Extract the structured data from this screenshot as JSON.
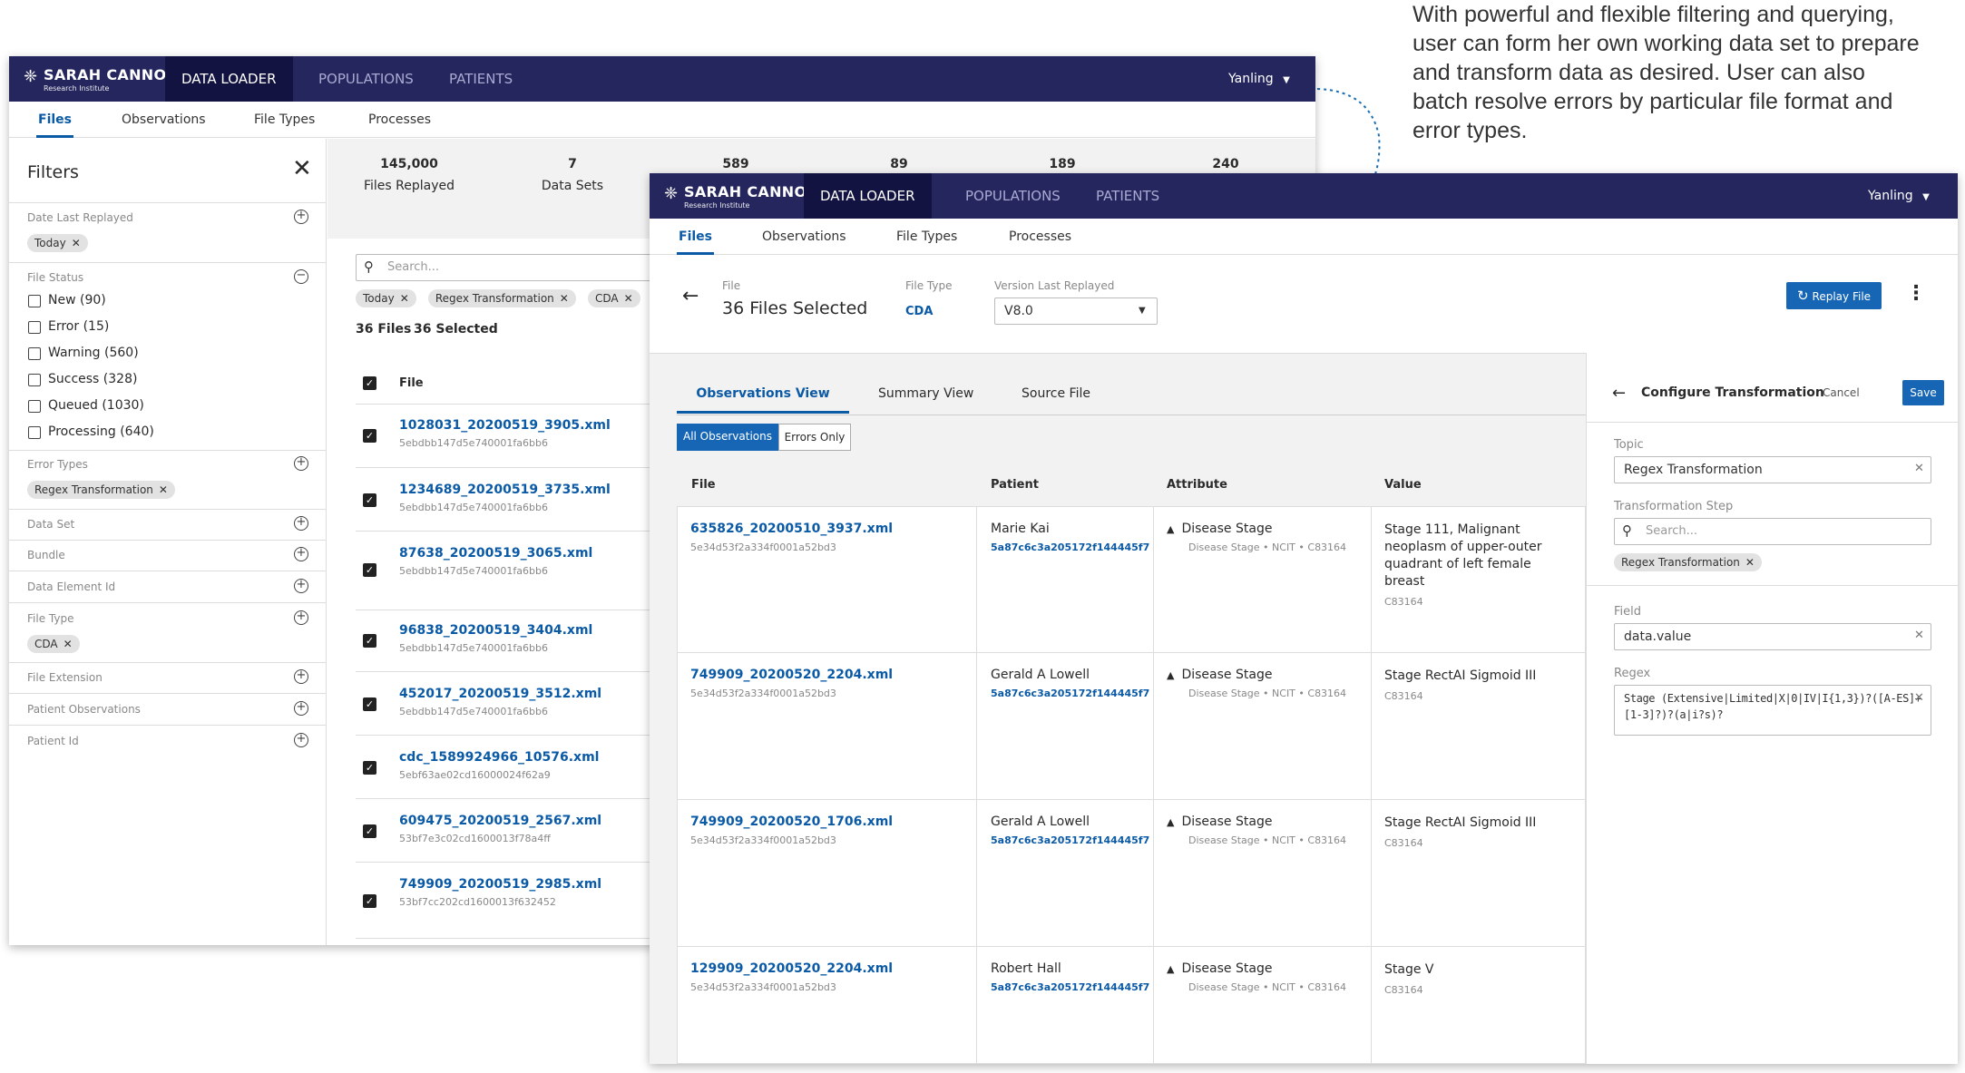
{
  "annotation": {
    "lines": [
      "With powerful and flexible filtering and querying,",
      "user can form her own working data set to prepare",
      "and transform data as desired. User can also",
      "batch resolve errors by particular file format and",
      "error types."
    ]
  },
  "brand": {
    "name": "SARAH CANNON",
    "sub": "Research Institute"
  },
  "nav": {
    "data_loader": "DATA LOADER",
    "populations": "POPULATIONS",
    "patients": "PATIENTS",
    "user": "Yanling"
  },
  "subnav": {
    "files": "Files",
    "observations": "Observations",
    "file_types": "File Types",
    "processes": "Processes"
  },
  "back_window": {
    "filters": {
      "title": "Filters",
      "date_last_replayed": "Date Last Replayed",
      "date_chip": "Today",
      "file_status": "File Status",
      "statuses": [
        "New (90)",
        "Error (15)",
        "Warning (560)",
        "Success (328)",
        "Queued (1030)",
        "Processing (640)"
      ],
      "error_types": "Error Types",
      "error_chip": "Regex Transformation",
      "data_set": "Data Set",
      "bundle": "Bundle",
      "data_element_id": "Data Element Id",
      "file_type": "File Type",
      "file_type_chip": "CDA",
      "file_extension": "File Extension",
      "patient_observations": "Patient Observations",
      "patient_id": "Patient Id"
    },
    "stats": [
      {
        "value": "145,000",
        "label": "Files Replayed"
      },
      {
        "value": "7",
        "label": "Data Sets"
      },
      {
        "value": "589",
        "label": ""
      },
      {
        "value": "89",
        "label": ""
      },
      {
        "value": "189",
        "label": ""
      },
      {
        "value": "240",
        "label": ""
      }
    ],
    "search_placeholder": "Search...",
    "chips": [
      "Today",
      "Regex Transformation",
      "CDA"
    ],
    "count_files": "36 Files",
    "count_selected": "36 Selected",
    "col_file": "File",
    "files": [
      {
        "name": "1028031_20200519_3905.xml",
        "hash": "5ebdbb147d5e740001fa6bb6"
      },
      {
        "name": "1234689_20200519_3735.xml",
        "hash": "5ebdbb147d5e740001fa6bb6"
      },
      {
        "name": "87638_20200519_3065.xml",
        "hash": "5ebdbb147d5e740001fa6bb6"
      },
      {
        "name": "96838_20200519_3404.xml",
        "hash": "5ebdbb147d5e740001fa6bb6"
      },
      {
        "name": "452017_20200519_3512.xml",
        "hash": "5ebdbb147d5e740001fa6bb6"
      },
      {
        "name": "cdc_1589924966_10576.xml",
        "hash": "5ebf63ae02cd16000024f62a9"
      },
      {
        "name": "609475_20200519_2567.xml",
        "hash": "53bf7e3c02cd1600013f78a4ff"
      },
      {
        "name": "749909_20200519_2985.xml",
        "hash": "53bf7cc202cd1600013f632452"
      }
    ]
  },
  "front_window": {
    "header": {
      "file_label": "File",
      "file_value": "36 Files Selected",
      "file_type_label": "File Type",
      "file_type_value": "CDA",
      "version_label": "Version Last Replayed",
      "version_value": "V8.0",
      "replay_button": "Replay File"
    },
    "view_tabs": {
      "observations": "Observations View",
      "summary": "Summary View",
      "source": "Source File"
    },
    "toggle": {
      "all": "All Observations",
      "errors": "Errors Only"
    },
    "columns": {
      "file": "File",
      "patient": "Patient",
      "attribute": "Attribute",
      "value": "Value"
    },
    "rows": [
      {
        "file": "635826_20200510_3937.xml",
        "hash": "5e34d53f2a334f0001a52bd3",
        "patient": "Marie Kai",
        "patient_id": "5a87c6c3a205172f144445f7",
        "attribute": "Disease Stage",
        "attr_meta": "Disease Stage  •  NCIT  •  C83164",
        "value_lines": [
          "Stage 111, Malignant",
          "neoplasm of upper-outer",
          "quadrant of left female",
          "breast"
        ],
        "value_code": "C83164"
      },
      {
        "file": "749909_20200520_2204.xml",
        "hash": "5e34d53f2a334f0001a52bd3",
        "patient": "Gerald A Lowell",
        "patient_id": "5a87c6c3a205172f144445f7",
        "attribute": "Disease Stage",
        "attr_meta": "Disease Stage  •  NCIT  •  C83164",
        "value_lines": [
          "Stage RectAI Sigmoid III"
        ],
        "value_code": "C83164"
      },
      {
        "file": "749909_20200520_1706.xml",
        "hash": "5e34d53f2a334f0001a52bd3",
        "patient": "Gerald A Lowell",
        "patient_id": "5a87c6c3a205172f144445f7",
        "attribute": "Disease Stage",
        "attr_meta": "Disease Stage  •  NCIT  •  C83164",
        "value_lines": [
          "Stage RectAI Sigmoid III"
        ],
        "value_code": "C83164"
      },
      {
        "file": "129909_20200520_2204.xml",
        "hash": "5e34d53f2a334f0001a52bd3",
        "patient": "Robert Hall",
        "patient_id": "5a87c6c3a205172f144445f7",
        "attribute": "Disease Stage",
        "attr_meta": "Disease Stage  •  NCIT  •  C83164",
        "value_lines": [
          "Stage V"
        ],
        "value_code": "C83164"
      }
    ],
    "panel": {
      "title": "Configure Transformation",
      "cancel": "Cancel",
      "save": "Save",
      "topic_label": "Topic",
      "topic_value": "Regex Transformation",
      "step_label": "Transformation Step",
      "step_placeholder": "Search...",
      "step_chip": "Regex Transformation",
      "field_label": "Field",
      "field_value": "data.value",
      "regex_label": "Regex",
      "regex_line1": "Stage (Extensive|Limited|X|0|IV|I{1,3})?([A-ES]+",
      "regex_line2": "[1-3]?)?(a|i?s)?"
    }
  },
  "colors": {
    "nav_bg": "#25265e",
    "nav_active": "#121340",
    "accent": "#0b5aa6",
    "button": "#1666b5"
  }
}
